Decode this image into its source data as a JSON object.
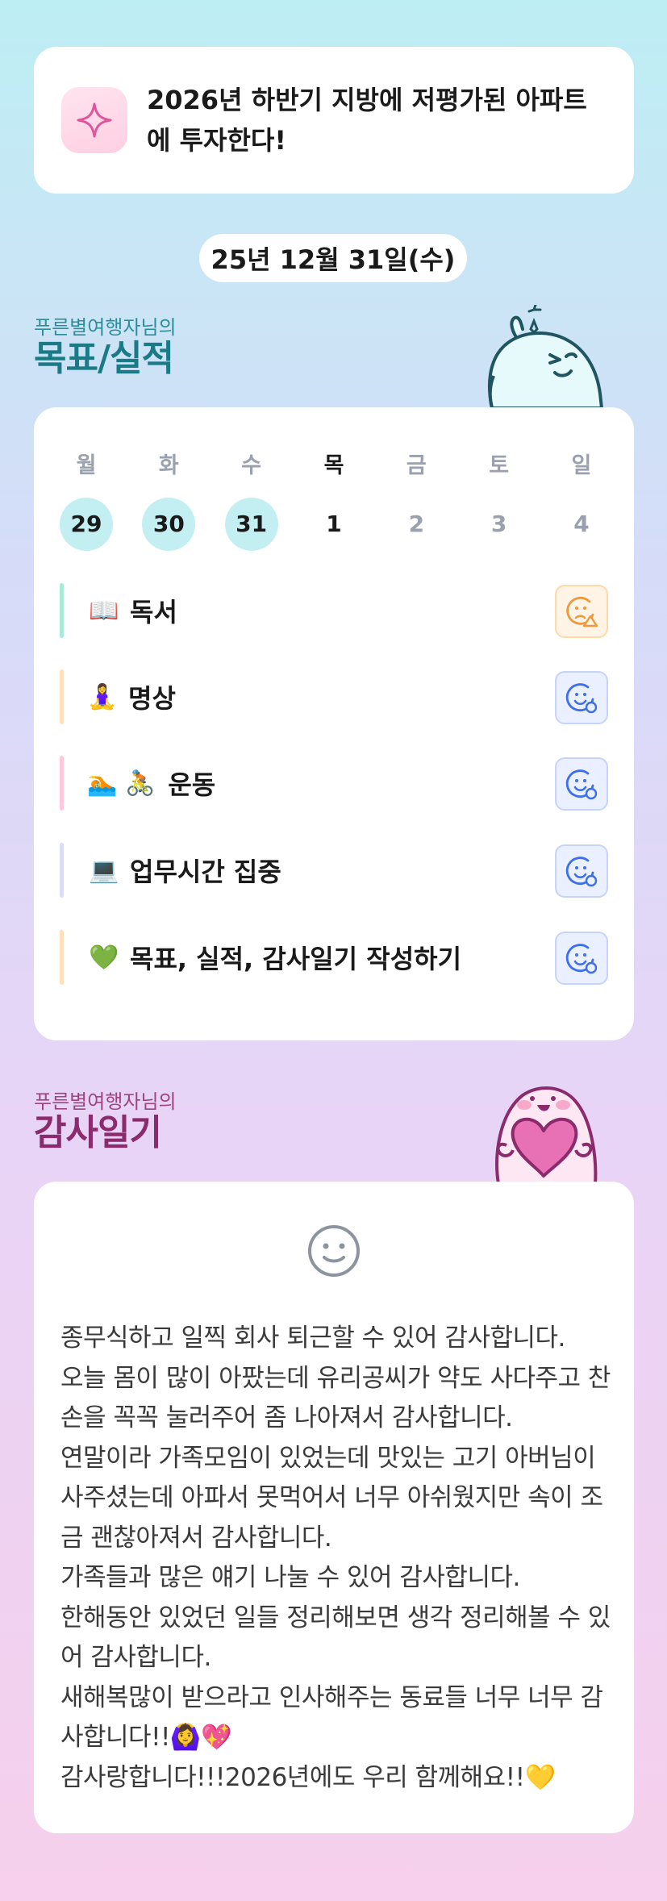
{
  "goal": {
    "text": "2026년 하반기 지방에 저평가된 아파트에 투자한다!",
    "icon": "sparkle-icon"
  },
  "date": "25년 12월 31일(수)",
  "goals_section": {
    "subtitle": "푸른별여행자님의",
    "title": "목표/실적"
  },
  "week": {
    "day_names": [
      "월",
      "화",
      "수",
      "목",
      "금",
      "토",
      "일"
    ],
    "day_numbers": [
      "29",
      "30",
      "31",
      "1",
      "2",
      "3",
      "4"
    ],
    "completed": [
      true,
      true,
      true,
      false,
      false,
      false,
      false
    ],
    "today_index": 3
  },
  "habits": [
    {
      "emoji": "📖",
      "label": "독서",
      "bar_color": "#a8ead8",
      "mood": "sad-warning"
    },
    {
      "emoji": "🧘‍♀️",
      "label": "명상",
      "bar_color": "#ffe0bd",
      "mood": "happy-check"
    },
    {
      "emoji": "🏊",
      "emoji2": "🚴",
      "label": "운동",
      "bar_color": "#ffc8de",
      "mood": "happy-check"
    },
    {
      "emoji": "💻",
      "label": "업무시간 집중",
      "bar_color": "#dcdcf6",
      "mood": "happy-check"
    },
    {
      "emoji": "💚",
      "label": "목표, 실적, 감사일기 작성하기",
      "bar_color": "#ffe0bd",
      "mood": "happy-check"
    }
  ],
  "gratitude_section": {
    "subtitle": "푸른별여행자님의",
    "title": "감사일기"
  },
  "diary": {
    "paragraphs": [
      "종무식하고 일찍 회사 퇴근할 수 있어 감사합니다.",
      "오늘 몸이 많이 아팠는데 유리공씨가 약도 사다주고 찬손을 꼭꼭 눌러주어 좀 나아져서 감사합니다.",
      "연말이라 가족모임이 있었는데 맛있는 고기 아버님이 사주셨는데 아파서 못먹어서 너무 아쉬웠지만 속이 조금 괜찮아져서 감사합니다.",
      "가족들과 많은 얘기 나눌 수 있어 감사합니다.",
      "한해동안 있었던 일들 정리해보면 생각 정리해볼 수 있어 감사합니다.",
      "새해복많이 받으라고 인사해주는 동료들 너무 너무 감사합니다!!🙆‍♀️💖",
      "감사랑합니다!!!2026년에도 우리 함께해요!!💛"
    ]
  },
  "colors": {
    "teal_title": "#1a7a86",
    "purple_title": "#8b2a6c",
    "done_day": "#c3eff2"
  }
}
